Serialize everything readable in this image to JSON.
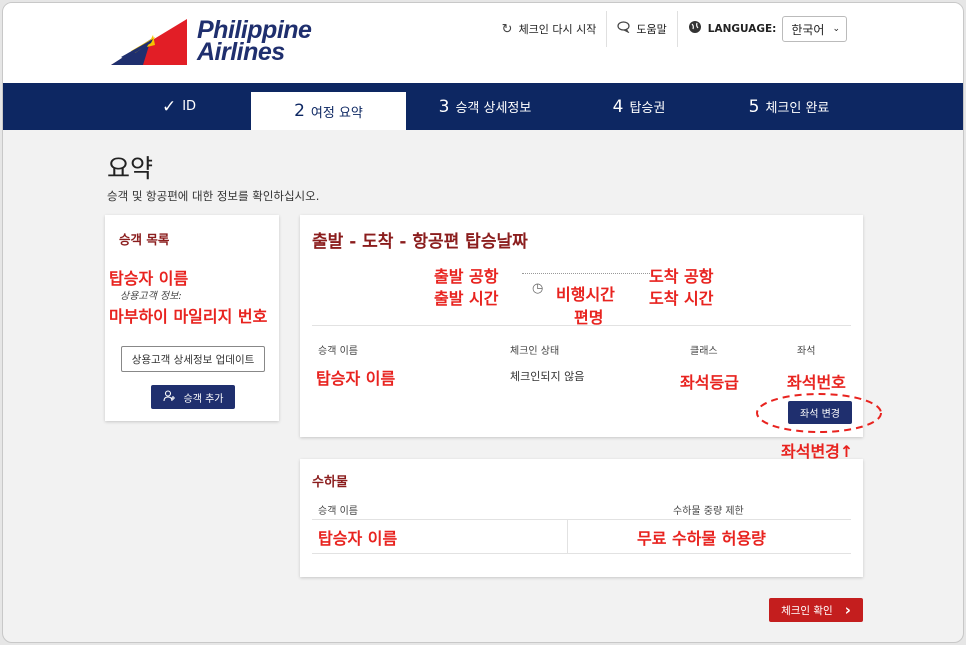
{
  "brand": {
    "name_line1": "Philippine",
    "name_line2": "Airlines",
    "colors": {
      "navy": "#0d2762",
      "logo_red": "#e21e26",
      "logo_yellow": "#f5c400",
      "logo_blue": "#1f2f6e",
      "annotation_red": "#e8231f"
    }
  },
  "top_nav": {
    "restart_icon": "refresh-icon",
    "restart_label": "체크인 다시 시작",
    "help_icon": "chat-bubble-icon",
    "help_label": "도움말",
    "language_icon": "globe-icon",
    "language_label": "LANGUAGE:",
    "language_value": "한국어"
  },
  "steps": [
    {
      "num": "",
      "label": "ID",
      "state": "done"
    },
    {
      "num": "2",
      "label": "여정 요약",
      "state": "active"
    },
    {
      "num": "3",
      "label": "승객 상세정보",
      "state": "pending"
    },
    {
      "num": "4",
      "label": "탑승권",
      "state": "pending"
    },
    {
      "num": "5",
      "label": "체크인 완료",
      "state": "pending"
    }
  ],
  "page": {
    "title": "요약",
    "subtitle": "승객 및 항공편에 대한 정보를 확인하십시오."
  },
  "passenger_list": {
    "title": "승객 목록",
    "name_annotation": "탑승자 이름",
    "frequent_flyer_label": "상용고객 정보:",
    "mileage_annotation": "마부하이 마일리지 번호",
    "update_button": "상용고객 상세정보 업데이트",
    "add_button": "승객 추가",
    "add_icon": "add-person-icon"
  },
  "flight": {
    "title": "출발 - 도착 - 항공편 탑승날짜",
    "departure_airport": "출발 공항",
    "departure_time": "출발 시간",
    "duration": "비행시간",
    "flight_number": "편명",
    "arrival_airport": "도착 공항",
    "arrival_time": "도착 시간",
    "clock_icon": "clock-icon",
    "columns": {
      "name": "승객 이름",
      "status": "체크인 상태",
      "class": "클래스",
      "seat": "좌석"
    },
    "row": {
      "name": "탑승자 이름",
      "status": "체크인되지 않음",
      "class": "좌석등급",
      "seat": "좌석번호"
    },
    "change_seat_button": "좌석 변경",
    "change_seat_annotation": "좌석변경↑"
  },
  "baggage": {
    "title": "수하물",
    "columns": {
      "name": "승객 이름",
      "limit": "수하물 중량 제한"
    },
    "row": {
      "name": "탑승자 이름",
      "limit": "무료 수하물 허용량"
    }
  },
  "confirm_button": "체크인 확인",
  "confirm_icon": "chevron-right-icon"
}
